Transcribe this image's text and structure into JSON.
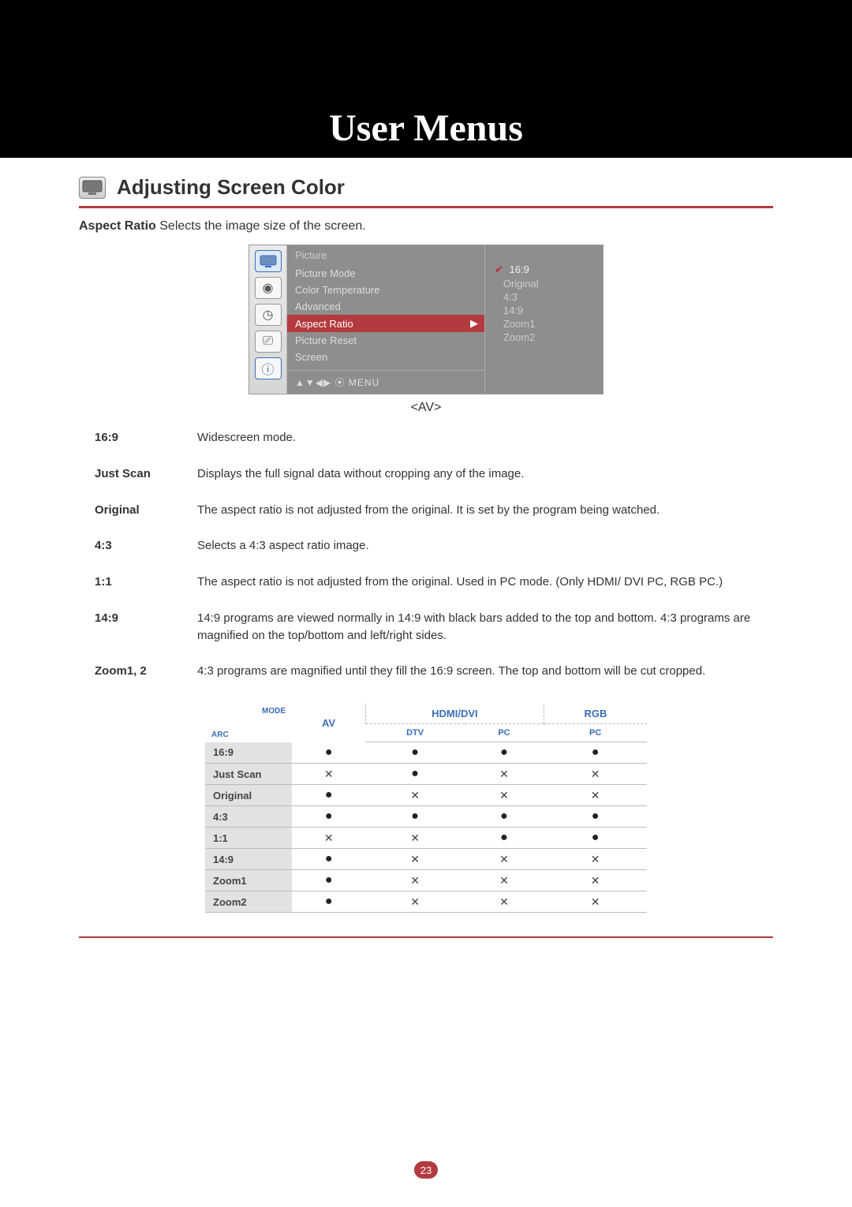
{
  "banner": {
    "title": "User Menus"
  },
  "section": {
    "title": "Adjusting Screen Color"
  },
  "lead": {
    "bold": "Aspect Ratio",
    "rest": " Selects the image size of the screen."
  },
  "osd": {
    "header": "Picture",
    "items": [
      "Picture Mode",
      "Color Temperature",
      "Advanced",
      "Aspect Ratio",
      "Picture Reset",
      "Screen"
    ],
    "selected_index": 3,
    "footer": "▲▼◀▶ ⦿ MENU",
    "options": [
      "16:9",
      "Original",
      "4:3",
      "14:9",
      "Zoom1",
      "Zoom2"
    ],
    "option_marker": "✔",
    "av_label": "<AV>"
  },
  "defs": [
    {
      "term": "16:9",
      "desc": "Widescreen mode."
    },
    {
      "term": "Just Scan",
      "desc": "Displays the full signal data without cropping any of the image."
    },
    {
      "term": "Original",
      "desc": "The aspect ratio is not adjusted from the original. It is set by the program being watched."
    },
    {
      "term": "4:3",
      "desc": "Selects a 4:3 aspect ratio image."
    },
    {
      "term": "1:1",
      "desc": "The aspect ratio is not adjusted from the original. Used in PC mode. (Only HDMI/ DVI PC, RGB PC.)"
    },
    {
      "term": "14:9",
      "desc": "14:9 programs are viewed normally in 14:9 with black bars added to the top and bottom. 4:3 programs are magnified on the top/bottom and left/right sides."
    },
    {
      "term": "Zoom1, 2",
      "desc": "4:3 programs are magnified until they fill the 16:9 screen. The top and bottom will be cut cropped."
    }
  ],
  "compat": {
    "corner": {
      "mode": "MODE",
      "arc": "ARC"
    },
    "col_groups": [
      "AV",
      "HDMI/DVI",
      "RGB"
    ],
    "sub_cols": {
      "hdmi": [
        "DTV",
        "PC"
      ],
      "rgb": [
        "PC"
      ]
    },
    "rows": [
      {
        "label": "16:9",
        "cells": [
          "dot",
          "dot",
          "dot",
          "dot"
        ]
      },
      {
        "label": "Just Scan",
        "cells": [
          "cross",
          "dot",
          "cross",
          "cross"
        ]
      },
      {
        "label": "Original",
        "cells": [
          "dot",
          "cross",
          "cross",
          "cross"
        ]
      },
      {
        "label": "4:3",
        "cells": [
          "dot",
          "dot",
          "dot",
          "dot"
        ]
      },
      {
        "label": "1:1",
        "cells": [
          "cross",
          "cross",
          "dot",
          "dot"
        ]
      },
      {
        "label": "14:9",
        "cells": [
          "dot",
          "cross",
          "cross",
          "cross"
        ]
      },
      {
        "label": "Zoom1",
        "cells": [
          "dot",
          "cross",
          "cross",
          "cross"
        ]
      },
      {
        "label": "Zoom2",
        "cells": [
          "dot",
          "cross",
          "cross",
          "cross"
        ]
      }
    ]
  },
  "page_number": "23"
}
